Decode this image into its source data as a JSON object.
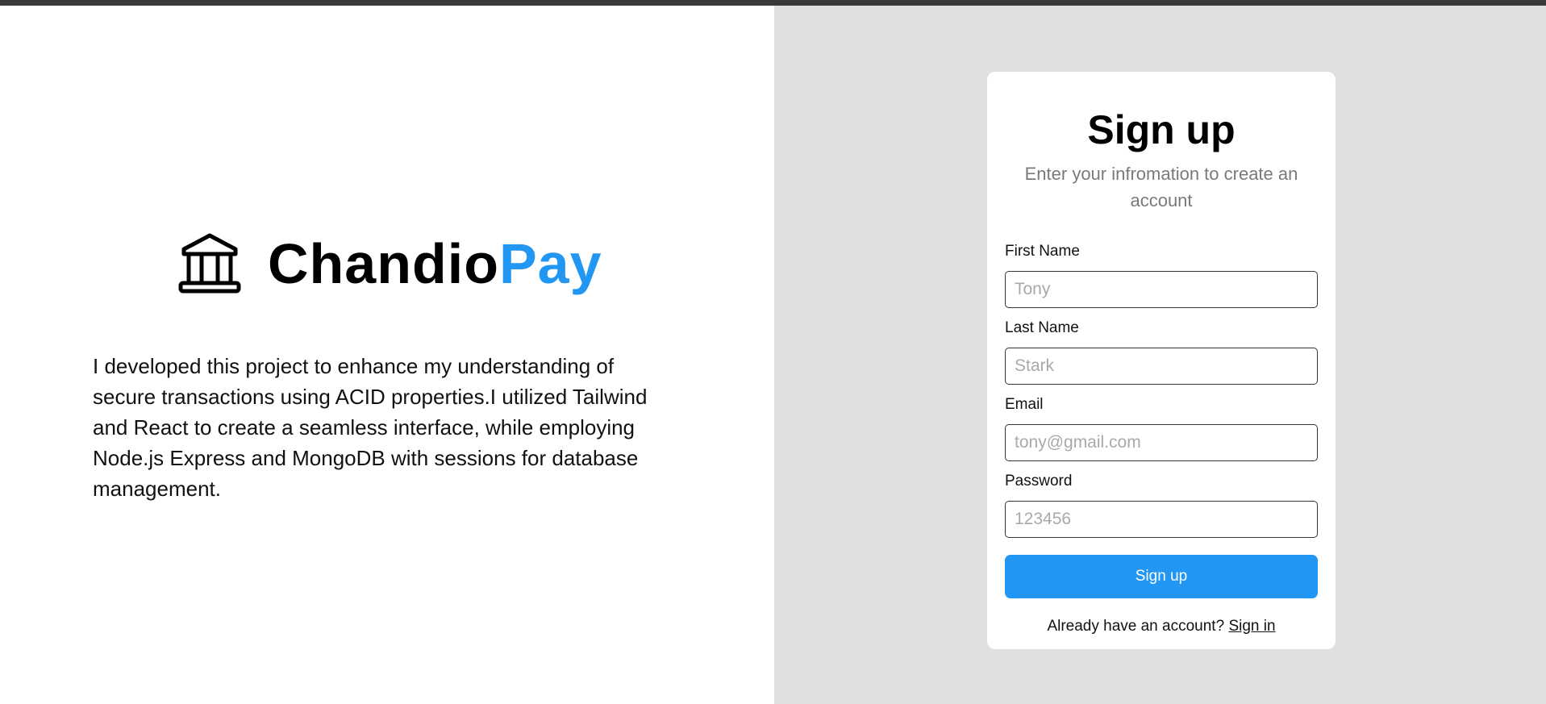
{
  "brand": {
    "icon": "bank-icon",
    "name_main": "Chandio",
    "name_accent": "Pay",
    "accent_color": "#2196f3"
  },
  "about": {
    "text": "I developed this project to enhance my understanding of secure transactions using ACID properties.I utilized Tailwind and React to create a seamless interface, while employing Node.js Express and MongoDB with sessions for database management."
  },
  "signup": {
    "title": "Sign up",
    "subtitle": "Enter your infromation to create an account",
    "fields": {
      "first_name": {
        "label": "First Name",
        "placeholder": "Tony",
        "value": ""
      },
      "last_name": {
        "label": "Last Name",
        "placeholder": "Stark",
        "value": ""
      },
      "email": {
        "label": "Email",
        "placeholder": "tony@gmail.com",
        "value": ""
      },
      "password": {
        "label": "Password",
        "placeholder": "123456",
        "value": ""
      }
    },
    "submit_label": "Sign up",
    "signin_prompt": "Already have an account?",
    "signin_link": "Sign in"
  },
  "colors": {
    "left_bg": "#ffffff",
    "right_bg": "#e0e0e0",
    "button_bg": "#2196f3"
  }
}
